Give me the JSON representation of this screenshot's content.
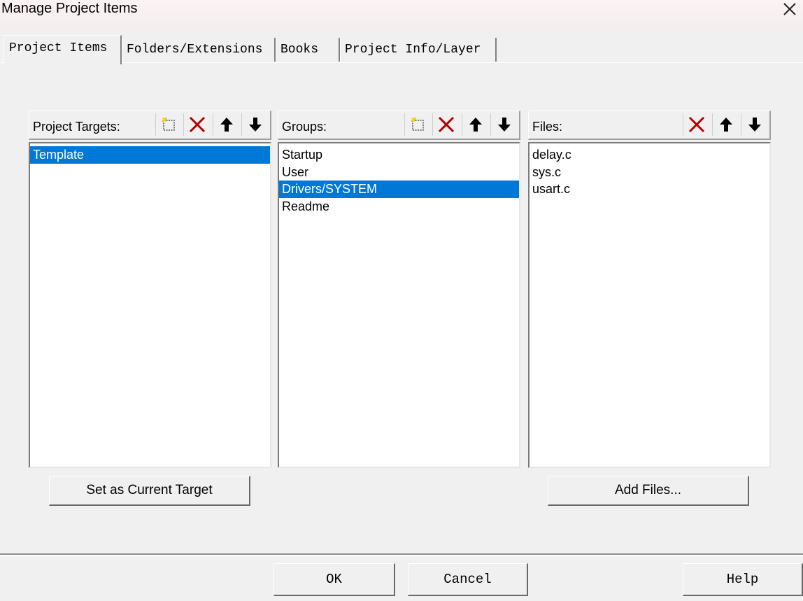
{
  "window": {
    "title": "Manage Project Items"
  },
  "tabs": [
    {
      "label": "Project Items",
      "active": true
    },
    {
      "label": "Folders/Extensions",
      "active": false
    },
    {
      "label": "Books",
      "active": false
    },
    {
      "label": "Project Info/Layer",
      "active": false
    }
  ],
  "targets": {
    "label": "Project Targets:",
    "items": [
      {
        "name": "Template",
        "selected": true
      }
    ],
    "set_current_label": "Set as Current Target"
  },
  "groups": {
    "label": "Groups:",
    "items": [
      {
        "name": "Startup",
        "selected": false
      },
      {
        "name": "User",
        "selected": false
      },
      {
        "name": "Drivers/SYSTEM",
        "selected": true
      },
      {
        "name": "Readme",
        "selected": false
      }
    ]
  },
  "files": {
    "label": "Files:",
    "items": [
      {
        "name": "delay.c",
        "selected": false
      },
      {
        "name": "sys.c",
        "selected": false
      },
      {
        "name": "usart.c",
        "selected": false
      }
    ],
    "add_files_label": "Add Files..."
  },
  "footer": {
    "ok_label": "OK",
    "cancel_label": "Cancel",
    "help_label": "Help"
  },
  "colors": {
    "selection": "#0078d7",
    "delete_icon": "#b40000"
  },
  "icons": {
    "new": "new-item-icon",
    "delete": "delete-icon",
    "up": "move-up-icon",
    "down": "move-down-icon",
    "close": "close-icon"
  }
}
